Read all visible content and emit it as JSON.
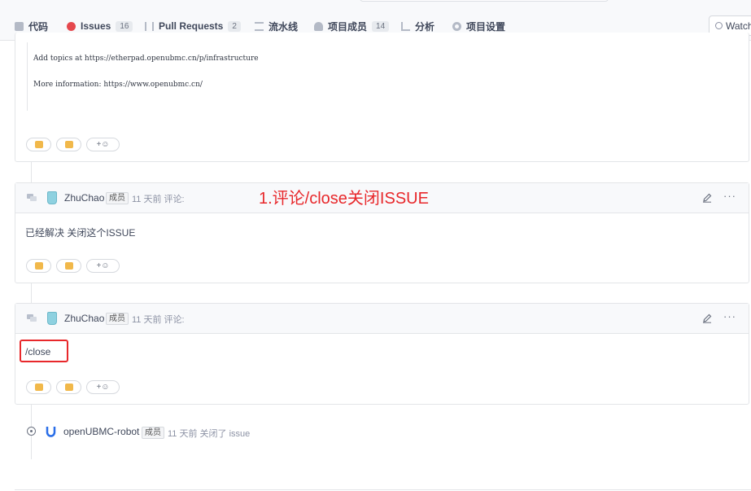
{
  "nav": {
    "items": [
      {
        "label": "代码",
        "badge": null
      },
      {
        "label": "Issues",
        "badge": "16"
      },
      {
        "label": "Pull Requests",
        "badge": "2"
      },
      {
        "label": "流水线",
        "badge": null
      },
      {
        "label": "项目成员",
        "badge": "14"
      },
      {
        "label": "分析",
        "badge": null
      },
      {
        "label": "项目设置",
        "badge": null
      }
    ],
    "watch_label": "Watch"
  },
  "first_comment": {
    "lines": [
      "Add topics at https://etherpad.openubmc.cn/p/infrastructure",
      "More information: https://www.openubmc.cn/"
    ]
  },
  "comments": [
    {
      "user": "ZhuChao",
      "role": "成员",
      "time": "11 天前 评论:",
      "body": "已经解决 关闭这个ISSUE"
    },
    {
      "user": "ZhuChao",
      "role": "成员",
      "time": "11 天前 评论:",
      "body": "/close"
    }
  ],
  "event": {
    "user": "openUBMC-robot",
    "role": "成员",
    "text": "11 天前 关闭了 issue"
  },
  "annotation": "1.评论/close关闭ISSUE",
  "reaction_add": "+☺",
  "colors": {
    "annotation": "#e8282b",
    "issues_icon": "#e5484d",
    "border": "#e3e5e8"
  }
}
